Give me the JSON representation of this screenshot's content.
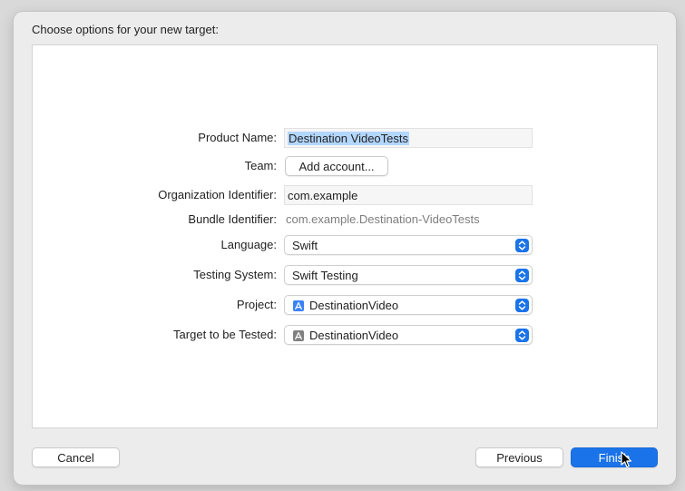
{
  "dialog": {
    "title": "Choose options for your new target:"
  },
  "form": {
    "product_name": {
      "label": "Product Name:",
      "value": "Destination VideoTests"
    },
    "team": {
      "label": "Team:",
      "button": "Add account..."
    },
    "organization_identifier": {
      "label": "Organization Identifier:",
      "value": "com.example"
    },
    "bundle_identifier": {
      "label": "Bundle Identifier:",
      "value": "com.example.Destination-VideoTests"
    },
    "language": {
      "label": "Language:",
      "value": "Swift"
    },
    "testing_system": {
      "label": "Testing System:",
      "value": "Swift Testing"
    },
    "project": {
      "label": "Project:",
      "value": "DestinationVideo",
      "icon": "app-project-icon"
    },
    "target_to_test": {
      "label": "Target to be Tested:",
      "value": "DestinationVideo",
      "icon": "app-target-icon"
    }
  },
  "buttons": {
    "cancel": "Cancel",
    "previous": "Previous",
    "finish": "Finish"
  },
  "colors": {
    "accent": "#1a73e8",
    "selection": "#b3d6fd"
  }
}
